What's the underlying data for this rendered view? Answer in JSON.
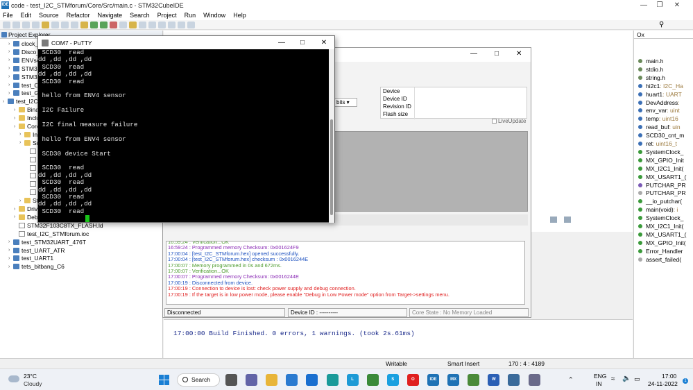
{
  "ide": {
    "title": "code - test_I2C_STMforum/Core/Src/main.c - STM32CubeIDE",
    "app_icon": "IDE",
    "menus": [
      "File",
      "Edit",
      "Source",
      "Refactor",
      "Navigate",
      "Search",
      "Project",
      "Run",
      "Window",
      "Help"
    ],
    "explorer_title": "Project Explorer",
    "explorer_items": [
      {
        "label": "clock_Stm",
        "depth": 1,
        "kind": "proj"
      },
      {
        "label": "Disco_UA",
        "depth": 1,
        "kind": "proj"
      },
      {
        "label": "ENVsens",
        "depth": 1,
        "kind": "proj"
      },
      {
        "label": "STM32_C",
        "depth": 1,
        "kind": "proj"
      },
      {
        "label": "STM32F_",
        "depth": 1,
        "kind": "proj"
      },
      {
        "label": "test_C8_I",
        "depth": 1,
        "kind": "proj"
      },
      {
        "label": "test_GPIO",
        "depth": 1,
        "kind": "proj"
      },
      {
        "label": "test_I2C_",
        "depth": 0,
        "kind": "proj"
      },
      {
        "label": "Binari",
        "depth": 2,
        "kind": "fold"
      },
      {
        "label": "Includ",
        "depth": 2,
        "kind": "fold"
      },
      {
        "label": "Core",
        "depth": 2,
        "kind": "fold"
      },
      {
        "label": "Inc",
        "depth": 3,
        "kind": "fold"
      },
      {
        "label": "Src",
        "depth": 3,
        "kind": "fold"
      },
      {
        "label": "",
        "depth": 4,
        "kind": "file"
      },
      {
        "label": "",
        "depth": 4,
        "kind": "file"
      },
      {
        "label": "",
        "depth": 4,
        "kind": "file"
      },
      {
        "label": "",
        "depth": 4,
        "kind": "file"
      },
      {
        "label": "",
        "depth": 4,
        "kind": "file"
      },
      {
        "label": "",
        "depth": 4,
        "kind": "file"
      },
      {
        "label": "Sta",
        "depth": 3,
        "kind": "fold"
      },
      {
        "label": "Driver",
        "depth": 2,
        "kind": "fold"
      },
      {
        "label": "Debu",
        "depth": 2,
        "kind": "fold"
      },
      {
        "label": "STM32F103C8TX_FLASH.ld",
        "depth": 2,
        "kind": "file"
      },
      {
        "label": "test_I2C_STMforum.ioc",
        "depth": 2,
        "kind": "file"
      },
      {
        "label": "test_STM32UART_476T",
        "depth": 1,
        "kind": "proj"
      },
      {
        "label": "test_UART_ATR",
        "depth": 1,
        "kind": "proj"
      },
      {
        "label": "test_UART1",
        "depth": 1,
        "kind": "proj"
      },
      {
        "label": "tets_bitbang_C6",
        "depth": 1,
        "kind": "proj"
      }
    ],
    "outline_title": "Ox",
    "outline_items": [
      {
        "label": "main.h",
        "type": "",
        "color": "#6a8a5a"
      },
      {
        "label": "stdio.h",
        "type": "",
        "color": "#6a8a5a"
      },
      {
        "label": "string.h",
        "type": "",
        "color": "#6a8a5a"
      },
      {
        "label": "hi2c1",
        "type": ": I2C_Ha",
        "color": "#3b6fb5"
      },
      {
        "label": "huart1",
        "type": ": UART",
        "color": "#3b6fb5"
      },
      {
        "label": "DevAddress",
        "type": ":",
        "color": "#3b6fb5"
      },
      {
        "label": "env_var",
        "type": ": uint",
        "color": "#3b6fb5"
      },
      {
        "label": "temp",
        "type": ": uint16",
        "color": "#3b6fb5"
      },
      {
        "label": "read_buf",
        "type": ": uin",
        "color": "#3b6fb5"
      },
      {
        "label": "SCD30_cnt_m",
        "type": "",
        "color": "#3b6fb5"
      },
      {
        "label": "ret",
        "type": ": uint16_t",
        "color": "#3b6fb5"
      },
      {
        "label": "SystemClock_",
        "type": "",
        "color": "#3a9a3a"
      },
      {
        "label": "MX_GPIO_Init",
        "type": "",
        "color": "#3a9a3a"
      },
      {
        "label": "MX_I2C1_Init(",
        "type": "",
        "color": "#3a9a3a"
      },
      {
        "label": "MX_USART1_(",
        "type": "",
        "color": "#3a9a3a"
      },
      {
        "label": "PUTCHAR_PR",
        "type": "",
        "color": "#7a5ab5"
      },
      {
        "label": "PUTCHAR_PR",
        "type": "",
        "color": "#aaaaaa"
      },
      {
        "label": "__io_putchar(",
        "type": "",
        "color": "#3a9a3a"
      },
      {
        "label": "main(void)",
        "type": ": i",
        "color": "#3a9a3a"
      },
      {
        "label": "SystemClock_",
        "type": "",
        "color": "#3a9a3a"
      },
      {
        "label": "MX_I2C1_Init(",
        "type": "",
        "color": "#3a9a3a"
      },
      {
        "label": "MX_USART1_(",
        "type": "",
        "color": "#3a9a3a"
      },
      {
        "label": "MX_GPIO_Init(",
        "type": "",
        "color": "#3a9a3a"
      },
      {
        "label": "Error_Handler",
        "type": "",
        "color": "#3a9a3a"
      },
      {
        "label": "assert_failed(",
        "type": "",
        "color": "#aaaaaa"
      }
    ],
    "console_line": "17:00:00 Build Finished. 0 errors, 1 warnings. (took 2s.61ms)",
    "status": {
      "writable": "Writable",
      "insert": "Smart Insert",
      "position": "170 : 4 : 4189"
    }
  },
  "programmer": {
    "bits": "bits",
    "device_labels": [
      "Device",
      "Device ID",
      "Revision ID",
      "Flash size"
    ],
    "live_update": "LiveUpdate",
    "log": [
      {
        "text": "16:59:24 : Verification...OK",
        "color": "#4a9a2a"
      },
      {
        "text": "16:59:24 : Programmed memory Checksum: 0x001624F9",
        "color": "#8a2ab5"
      },
      {
        "text": "17:00:04 : [test_I2C_STMforum.hex] opened successfully.",
        "color": "#1a4fbf"
      },
      {
        "text": "17:00:04 : [test_I2C_STMforum.hex] checksum : 0x0016244E",
        "color": "#1a4fbf"
      },
      {
        "text": "17:00:07 : Memory programmed in 0s and 672ms.",
        "color": "#4a9a2a"
      },
      {
        "text": "17:00:07 : Verification...OK",
        "color": "#4a9a2a"
      },
      {
        "text": "17:00:07 : Programmed memory Checksum: 0x0016244E",
        "color": "#8a2ab5"
      },
      {
        "text": "17:00:19 : Disconnected from device.",
        "color": "#1a4fbf"
      },
      {
        "text": "17:00:19 : Connection to device is lost: check power supply and debug connection.",
        "color": "#e02020"
      },
      {
        "text": "17:00:19 : If the target is in low power mode, please enable \"Debug in Low Power mode\" option from Target->settings menu.",
        "color": "#e02020"
      }
    ],
    "status_disconnected": "Disconnected",
    "status_device_id": "Device ID : ----------",
    "status_core": "Core State : No Memory Loaded"
  },
  "putty": {
    "title": "COM7 - PuTTY",
    "lines": [
      " SCD30  read",
      "dd ,dd ,dd ,dd",
      " SCD30  read",
      "dd ,dd ,dd ,dd",
      " SCD30  read",
      "",
      " hello from ENV4 sensor",
      "",
      " I2C Failure",
      "",
      " I2C final measure failure",
      "",
      " hello from ENV4 sensor",
      "",
      " SCD30 device Start",
      "",
      " SCD30  read",
      "dd ,dd ,dd ,dd",
      " SCD30  read",
      "dd ,dd ,dd ,dd",
      " SCD30  read",
      "dd ,dd ,dd ,dd",
      " SCD30  read"
    ]
  },
  "taskbar": {
    "temperature": "23°C",
    "condition": "Cloudy",
    "search": "Search",
    "lang1": "ENG",
    "lang2": "IN",
    "time": "17:00",
    "date": "24-11-2022",
    "apps": [
      {
        "name": "task-view",
        "label": "",
        "color": "#555555"
      },
      {
        "name": "teams",
        "label": "",
        "color": "#6264a7"
      },
      {
        "name": "file-explorer",
        "label": "",
        "color": "#e8b53a"
      },
      {
        "name": "photos",
        "label": "",
        "color": "#2a7ad0"
      },
      {
        "name": "mail",
        "label": "",
        "color": "#1a6fd0"
      },
      {
        "name": "edge",
        "label": "",
        "color": "#1a9a9a"
      },
      {
        "name": "l-app",
        "label": "L",
        "color": "#1d9ad6"
      },
      {
        "name": "notes",
        "label": "",
        "color": "#3a8a3a"
      },
      {
        "name": "skype",
        "label": "S",
        "color": "#1aa0e0"
      },
      {
        "name": "opera",
        "label": "O",
        "color": "#e02020"
      },
      {
        "name": "cube-ide",
        "label": "IDE",
        "color": "#1f72b5"
      },
      {
        "name": "cube-mx",
        "label": "MX",
        "color": "#1f72b5"
      },
      {
        "name": "app-green",
        "label": "",
        "color": "#4a8a3a"
      },
      {
        "name": "word",
        "label": "W",
        "color": "#2b5fb5"
      },
      {
        "name": "app-screen",
        "label": "",
        "color": "#3a6a9a"
      },
      {
        "name": "putty",
        "label": "",
        "color": "#6a6a8a"
      }
    ]
  }
}
